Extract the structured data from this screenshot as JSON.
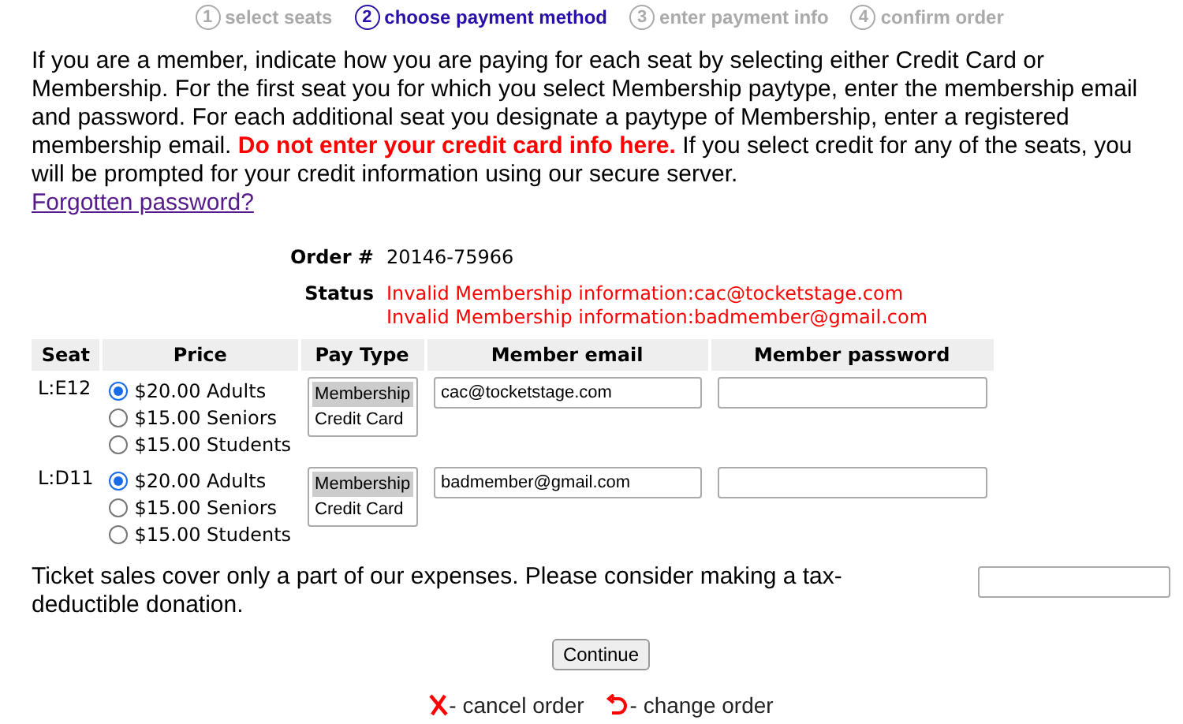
{
  "steps": [
    {
      "number": "1",
      "label": "select seats",
      "selected": false
    },
    {
      "number": "2",
      "label": "choose payment method",
      "selected": true
    },
    {
      "number": "3",
      "label": "enter payment info",
      "selected": false
    },
    {
      "number": "4",
      "label": "confirm order",
      "selected": false
    }
  ],
  "intro": "If you are a member, indicate how you are paying for each seat by selecting either Credit Card or Membership. For the first seat you for which you select Membership paytype, enter the membership email and password. For each additional seat you designate a paytype of Membership, enter a registered membership email. **Do not enter your credit card info here.** If you select credit for any of the seats, you will be prompted for your credit information using our secure server.",
  "forgot_link": "Forgotten password?",
  "order": {
    "label": "Order #",
    "value": "20146-75966"
  },
  "status": {
    "label": "Status",
    "messages": [
      "Invalid Membership information:cac@tocketstage.com",
      "Invalid Membership information:badmember@gmail.com"
    ]
  },
  "table": {
    "columns": [
      "Seat",
      "Price",
      "Pay Type",
      "Member email",
      "Member password"
    ],
    "rows": [
      {
        "seat": "L:E12",
        "prices": [
          {
            "label": "$20.00 Adults",
            "selected": true
          },
          {
            "label": "$15.00 Seniors",
            "selected": false
          },
          {
            "label": "$15.00 Students",
            "selected": false
          }
        ],
        "pay_types": [
          {
            "label": "Membership",
            "selected": true
          },
          {
            "label": "Credit Card",
            "selected": false
          }
        ],
        "email": "cac@tocketstage.com"
      },
      {
        "seat": "L:D11",
        "prices": [
          {
            "label": "$20.00 Adults",
            "selected": true
          },
          {
            "label": "$15.00 Seniors",
            "selected": false
          },
          {
            "label": "$15.00 Students",
            "selected": false
          }
        ],
        "pay_types": [
          {
            "label": "Membership",
            "selected": true
          },
          {
            "label": "Credit Card",
            "selected": false
          }
        ],
        "email": "badmember@gmail.com"
      }
    ]
  },
  "donation": "Ticket sales cover only a part of our expenses. Please consider making a tax-deductible donation.",
  "continue_button": "Continue",
  "actions": [
    {
      "kind": "cancel",
      "label": "- cancel order"
    },
    {
      "kind": "change",
      "label": "- change order"
    }
  ]
}
